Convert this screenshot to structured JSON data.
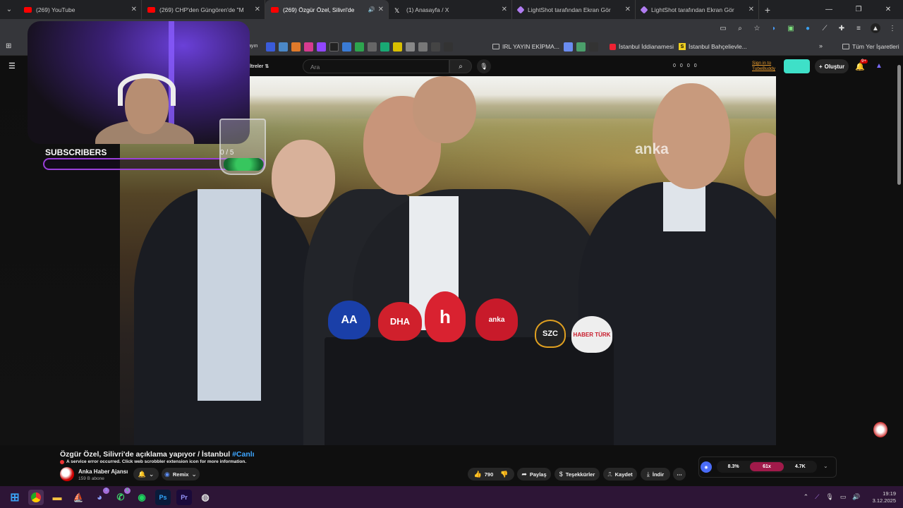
{
  "browser": {
    "tabs": [
      {
        "title": "(269) YouTube",
        "favicon_color": "#ff0000"
      },
      {
        "title": "(269) CHP'den Güngören'de \"M",
        "favicon_color": "#ff0000"
      },
      {
        "title": "(269) Özgür Özel, Silivri'de",
        "favicon_color": "#ff0000",
        "active": true
      },
      {
        "title": "(1) Anasayfa / X",
        "favicon_color": "#ffffff"
      },
      {
        "title": "LightShot tarafından Ekran Gör",
        "favicon_color": "#b07cf0"
      },
      {
        "title": "LightShot tarafından Ekran Gör",
        "favicon_color": "#b07cf0"
      }
    ],
    "bookmarks": {
      "partial_first": "ayın",
      "irl": "IRL YAYIN EKİPMA...",
      "iddianamesi": "İstanbul İddianamesi",
      "bahcelievler": "İstanbul Bahçelievle...",
      "all": "Tüm Yer İşaretleri"
    }
  },
  "youtube": {
    "filters_label": "iltreler",
    "search_placeholder": "Ara",
    "ext_counts": [
      "0",
      "0",
      "0",
      "0"
    ],
    "signin_line1": "Sign in to",
    "signin_line2": "TubeBuddy",
    "create_label": "Oluştur",
    "notif_badge": "9+",
    "video_watermark": "anka",
    "video_title": "Özgür Özel, Silivri'de açıklama yapıyor / İstanbul",
    "video_tag": "#Canlı",
    "error_msg": "A service error occurred. Click web scrobbler extension icon for more information.",
    "channel_name": "Anka Haber Ajansı",
    "channel_subs": "159 B abone",
    "remix_label": "Remix",
    "likes": "790",
    "share_label": "Paylaş",
    "thanks_label": "Teşekkürler",
    "save_label": "Kaydet",
    "download_label": "İndir",
    "ratio": {
      "left": "8.3%",
      "mid": "61x",
      "right": "4.7K"
    }
  },
  "overlay": {
    "subs_label": "SUBSCRIBERS",
    "subs_count": "0 / 5"
  },
  "microphones": [
    "AA",
    "DHA",
    "h",
    "anka",
    "SZC",
    "HABER TÜRK"
  ],
  "taskbar": {
    "time": "19:19",
    "date": "3.12.2025",
    "discord_badge": "3",
    "whatsapp_badge": "1"
  }
}
